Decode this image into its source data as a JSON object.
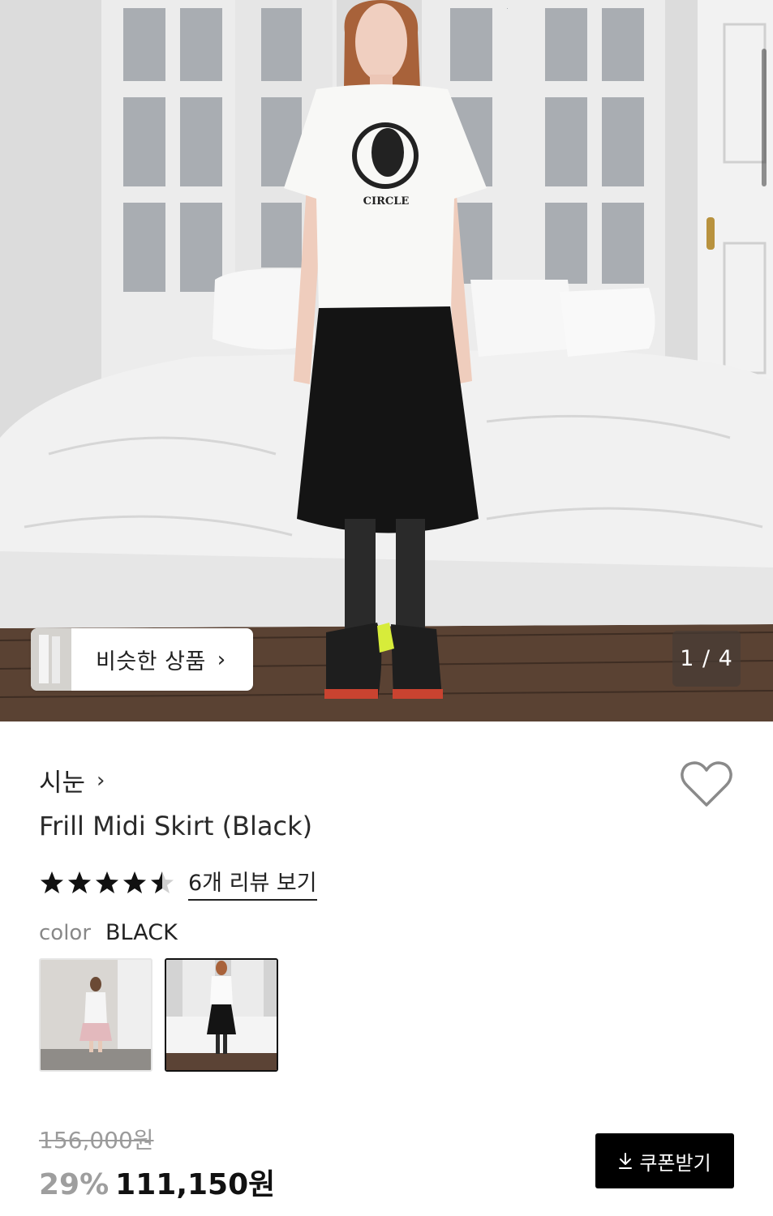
{
  "gallery": {
    "similar_label": "비슷한 상품",
    "similar_chevron": "›",
    "counter": "1 / 4"
  },
  "product": {
    "brand": "시눈",
    "brand_chevron": "›",
    "title": "Frill Midi Skirt (Black)",
    "rating": 4.5,
    "review_link": "6개 리뷰 보기",
    "color_label": "color",
    "color_value": "BLACK",
    "tshirt_print": "CIRCLE",
    "original_price": "156,000원",
    "discount": "29%",
    "sale_price": "111,150원",
    "coupon_button": "쿠폰받기"
  },
  "icons": {
    "wish": "heart-outline-icon",
    "chevron": "chevron-right-icon",
    "star": "star-icon",
    "download": "download-icon"
  },
  "colors": {
    "button_bg": "#000000",
    "discount": "#9e9e9e",
    "star": "#111111"
  }
}
